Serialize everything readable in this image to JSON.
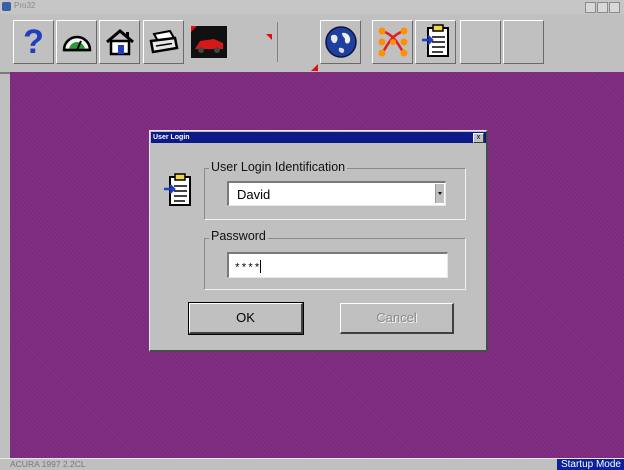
{
  "window": {
    "title": "Pro32"
  },
  "toolbar": {
    "buttons": [
      {
        "icon": "help-icon"
      },
      {
        "icon": "gauge-icon"
      },
      {
        "icon": "home-icon"
      },
      {
        "icon": "printer-icon"
      },
      {
        "icon": "car-icon"
      },
      {
        "icon": "globe-icon"
      },
      {
        "icon": "network-icon"
      },
      {
        "icon": "clipboard-login-icon"
      }
    ],
    "colors": {
      "help": "#1f3fbf",
      "globe": "#1e3f9e",
      "network_dots": "#ff9000"
    }
  },
  "dialog": {
    "title": "User Login",
    "close_label": "x",
    "user_group_label": "User Login Identification",
    "user_value": "David",
    "password_group_label": "Password",
    "password_value": "****",
    "ok_label": "OK",
    "cancel_label": "Cancel"
  },
  "status": {
    "vehicle": "ACURA  1997  2.2CL",
    "mode": "Startup Mode"
  },
  "colors": {
    "desktop": "#7c2a7e",
    "dialog_title": "#0b1a86",
    "status_mode": "#0c1fa0"
  }
}
